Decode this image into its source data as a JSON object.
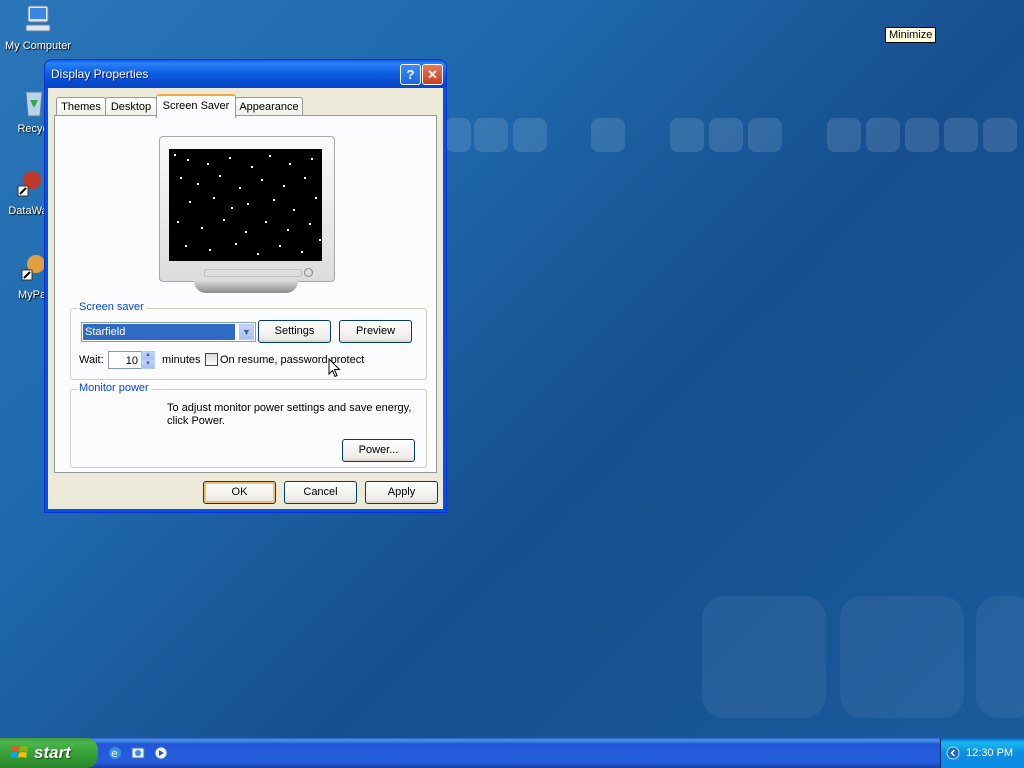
{
  "desktop": {
    "icons": [
      {
        "label": "My Computer"
      },
      {
        "label": "Recycl"
      },
      {
        "label": "DataWa"
      },
      {
        "label": "MyPa"
      }
    ],
    "tooltip": "Minimize"
  },
  "window": {
    "title": "Display Properties",
    "help_glyph": "?",
    "close_glyph": "✕",
    "tabs": [
      {
        "label": "Themes"
      },
      {
        "label": "Desktop"
      },
      {
        "label": "Screen Saver",
        "active": true
      },
      {
        "label": "Appearance"
      }
    ],
    "screen_saver": {
      "group_label": "Screen saver",
      "selected": "Starfield",
      "settings_label": "Settings",
      "preview_label": "Preview",
      "wait_label": "Wait:",
      "wait_value": "10",
      "minutes_label": "minutes",
      "password_label": "On resume, password protect",
      "password_checked": false
    },
    "monitor_power": {
      "group_label": "Monitor power",
      "description": "To adjust monitor power settings and save energy, click Power.",
      "power_label": "Power..."
    },
    "ok_label": "OK",
    "cancel_label": "Cancel",
    "apply_label": "Apply"
  },
  "taskbar": {
    "start_label": "start",
    "clock": "12:30 PM"
  },
  "colors": {
    "desktop": "#1f6aae",
    "titlebar": "#0054e3",
    "accent_tab": "#f3a83a",
    "start_green": "#37a137"
  }
}
